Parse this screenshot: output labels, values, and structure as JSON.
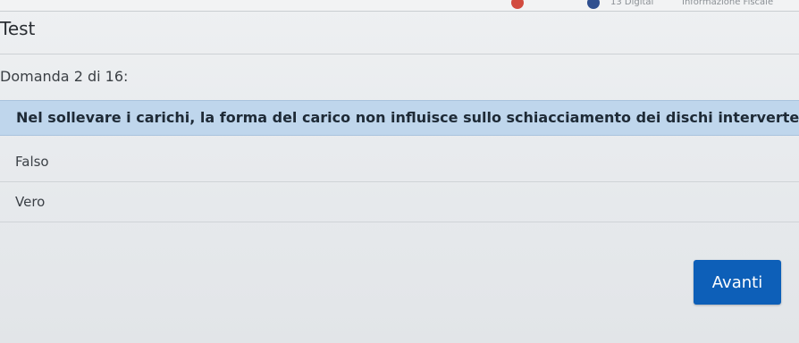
{
  "browser_bar": {
    "digital_label": "13 Digital",
    "fiscal_label": "Informazione Fiscale"
  },
  "quiz": {
    "title": "Test",
    "progress": "Domanda 2 di 16:",
    "question": "Nel sollevare i carichi, la forma del carico non influisce sullo schiacciamento dei dischi intervertebrali",
    "options": [
      {
        "label": "Falso"
      },
      {
        "label": "Vero"
      }
    ],
    "next_label": "Avanti"
  },
  "colors": {
    "question_bg": "#bfd6ec",
    "button_bg": "#0d5fb8"
  }
}
